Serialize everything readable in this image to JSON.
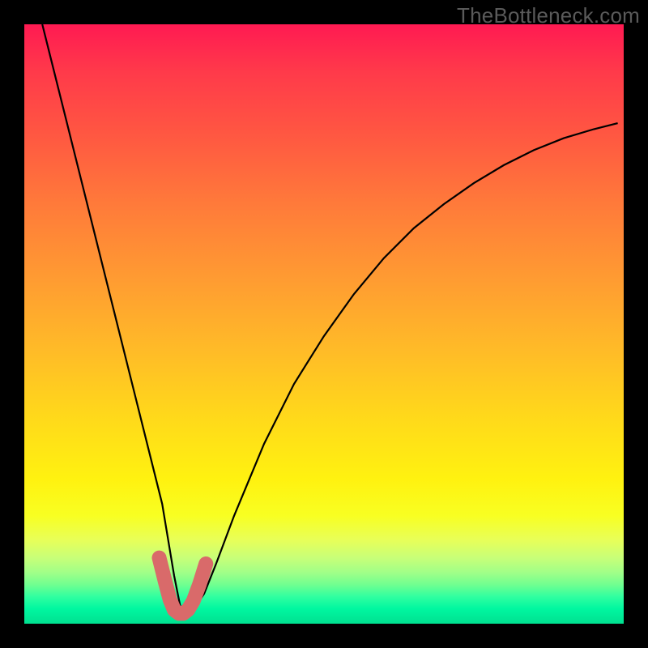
{
  "watermark": "TheBottleneck.com",
  "chart_data": {
    "type": "line",
    "title": "",
    "xlabel": "",
    "ylabel": "",
    "xlim": [
      0,
      100
    ],
    "ylim": [
      0,
      100
    ],
    "grid": false,
    "legend": false,
    "series": [
      {
        "name": "bottleneck-curve",
        "color": "#000000",
        "x": [
          3,
          5,
          7,
          9,
          11,
          13,
          15,
          17,
          19,
          21,
          23,
          24,
          25,
          26,
          27,
          28,
          30,
          32,
          35,
          40,
          45,
          50,
          55,
          60,
          65,
          70,
          75,
          80,
          85,
          90,
          95,
          99
        ],
        "y": [
          100,
          92,
          84,
          76,
          68,
          60,
          52,
          44,
          36,
          28,
          20,
          14,
          8,
          3,
          1.5,
          2,
          5,
          10,
          18,
          30,
          40,
          48,
          55,
          61,
          66,
          70,
          73.5,
          76.5,
          79,
          81,
          82.5,
          83.5
        ]
      },
      {
        "name": "optimal-highlight",
        "color": "#d96a6a",
        "x": [
          22.5,
          23.5,
          24.3,
          25.0,
          25.8,
          26.5,
          27.3,
          28.2,
          29.2,
          30.3
        ],
        "y": [
          11.0,
          7.0,
          4.0,
          2.3,
          1.7,
          1.7,
          2.3,
          3.8,
          6.5,
          10.0
        ]
      }
    ],
    "gradient_stops": [
      {
        "pos": 0,
        "color": "#ff1a52"
      },
      {
        "pos": 18,
        "color": "#ff5642"
      },
      {
        "pos": 42,
        "color": "#ff9a32"
      },
      {
        "pos": 66,
        "color": "#ffda1a"
      },
      {
        "pos": 82,
        "color": "#f8ff22"
      },
      {
        "pos": 95,
        "color": "#30ffa0"
      },
      {
        "pos": 100,
        "color": "#00e090"
      }
    ]
  }
}
